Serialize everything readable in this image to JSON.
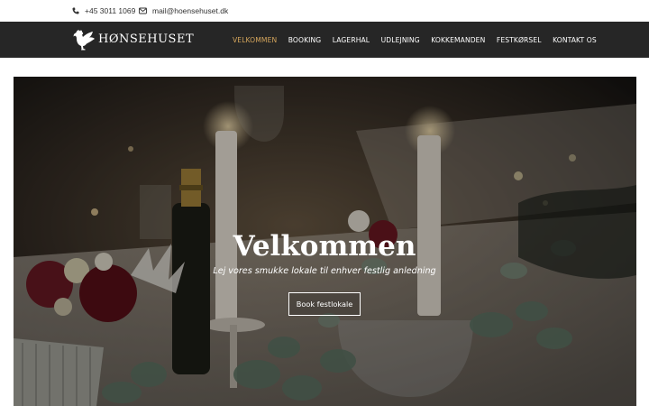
{
  "contact": {
    "phone": "+45 3011 1069",
    "email": "mail@hoensehuset.dk",
    "phone_icon": "phone-icon",
    "email_icon": "envelope-icon"
  },
  "brand": {
    "logo_icon": "rooster-icon",
    "name": "HØNSEHUSET"
  },
  "nav": {
    "items": [
      {
        "label": "VELKOMMEN",
        "active": true
      },
      {
        "label": "BOOKING"
      },
      {
        "label": "LAGERHAL"
      },
      {
        "label": "UDLEJNING"
      },
      {
        "label": "KOKKEMANDEN"
      },
      {
        "label": "FESTKØRSEL"
      },
      {
        "label": "KONTAKT OS"
      }
    ]
  },
  "hero": {
    "title": "Velkommen",
    "subtitle": "Lej vores smukke lokale til enhver festlig anledning",
    "button_label": "Book festlokale"
  },
  "colors": {
    "nav_bg": "#262626",
    "active_link": "#d4a55c",
    "text_light": "#ffffff"
  }
}
